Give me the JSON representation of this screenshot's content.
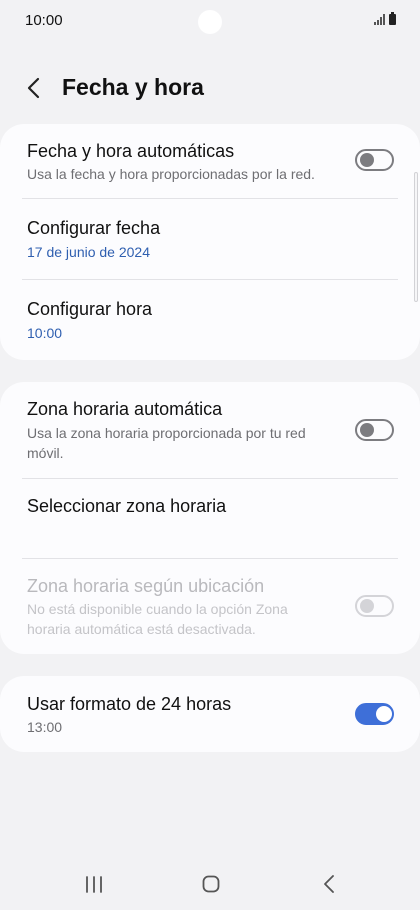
{
  "status_bar": {
    "time": "10:00"
  },
  "header": {
    "title": "Fecha y hora"
  },
  "section1": {
    "auto_datetime": {
      "title": "Fecha y hora automáticas",
      "subtitle": "Usa la fecha y hora proporcionadas por la red.",
      "enabled": false
    },
    "set_date": {
      "title": "Configurar fecha",
      "value": "17 de junio de 2024"
    },
    "set_time": {
      "title": "Configurar hora",
      "value": "10:00"
    }
  },
  "section2": {
    "auto_timezone": {
      "title": "Zona horaria automática",
      "subtitle": "Usa la zona horaria proporcionada por tu red móvil.",
      "enabled": false
    },
    "select_timezone": {
      "title": "Seleccionar zona horaria"
    },
    "location_timezone": {
      "title": "Zona horaria según ubicación",
      "subtitle": "No está disponible cuando la opción Zona horaria automática está desactivada.",
      "enabled": false,
      "disabled": true
    }
  },
  "section3": {
    "format_24h": {
      "title": "Usar formato de 24 horas",
      "value": "13:00",
      "enabled": true
    }
  },
  "colors": {
    "accent": "#3e6fd8",
    "value_text": "#2f5fb0",
    "background": "#f2f2f4",
    "card": "#fcfcfe"
  },
  "icons": {
    "back": "chevron-left-icon",
    "signal": "signal-icon",
    "battery": "battery-icon",
    "nav_recents": "recent-apps-icon",
    "nav_home": "home-icon",
    "nav_back": "back-icon"
  }
}
